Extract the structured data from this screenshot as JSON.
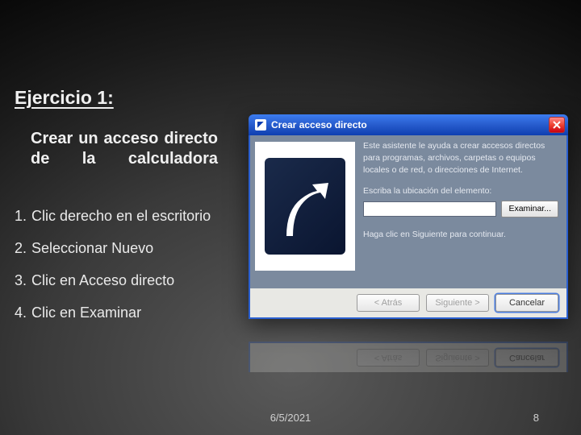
{
  "title": "Ejercicio 1:",
  "subtitle": "Crear un acceso directo de la calculadora",
  "steps": [
    {
      "n": "1.",
      "text": "Clic derecho en el escritorio"
    },
    {
      "n": "2.",
      "text": "Seleccionar Nuevo"
    },
    {
      "n": "3.",
      "text": "Clic en Acceso directo"
    },
    {
      "n": "4.",
      "text": "Clic en Examinar"
    }
  ],
  "dialog": {
    "title": "Crear acceso directo",
    "instruction": "Este asistente le ayuda a crear accesos directos para programas, archivos, carpetas o equipos locales o de red, o direcciones de Internet.",
    "location_label": "Escriba la ubicación del elemento:",
    "location_value": "",
    "examine": "Examinar...",
    "continue": "Haga clic en Siguiente para continuar.",
    "back": "< Atrás",
    "next": "Siguiente >",
    "cancel": "Cancelar"
  },
  "footer": {
    "date": "6/5/2021",
    "page": "8"
  }
}
